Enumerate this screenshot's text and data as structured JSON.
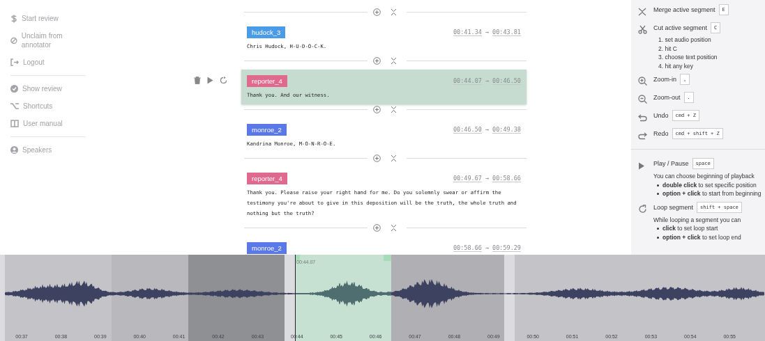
{
  "sidebar": {
    "groups": [
      {
        "items": [
          {
            "label": "Start review"
          },
          {
            "label": "Unclaim from annotator"
          },
          {
            "label": "Logout"
          }
        ]
      },
      {
        "items": [
          {
            "label": "Show review"
          },
          {
            "label": "Shortcuts"
          },
          {
            "label": "User manual"
          }
        ]
      },
      {
        "items": [
          {
            "label": "Speakers"
          }
        ]
      }
    ]
  },
  "segments": [
    {
      "speaker": "hudock_3",
      "color": "#4a9be8",
      "start": "00:41.34",
      "arrow": "→",
      "end": "00:43.81",
      "text": "Chris Hudock, H-U-D-O-C-K.",
      "selected": false
    },
    {
      "speaker": "reporter_4",
      "color": "#e0698f",
      "start": "00:44.07",
      "arrow": "→",
      "end": "00:46.50",
      "text": "Thank you. And our witness.",
      "selected": true
    },
    {
      "speaker": "monroe_2",
      "color": "#5b78e8",
      "start": "00:46.50",
      "arrow": "→",
      "end": "00:49.38",
      "text": "Kandrina Monroe, M-O-N-R-O-E.",
      "selected": false
    },
    {
      "speaker": "reporter_4",
      "color": "#e0698f",
      "start": "00:49.67",
      "arrow": "→",
      "end": "00:58.66",
      "text": "Thank you. Please raise your right hand for me. Do you solemnly swear or affirm the testimony you're about to give in this deposition will be the truth, the whole truth and nothing but the truth?",
      "selected": false
    },
    {
      "speaker": "monroe_2",
      "color": "#5b78e8",
      "start": "00:58.66",
      "arrow": "→",
      "end": "00:59.29",
      "selected": false
    }
  ],
  "shortcuts": {
    "sections": [
      {
        "items": [
          {
            "label": "Merge active segment",
            "key": "E"
          },
          {
            "label": "Cut active segment",
            "key": "C",
            "steps": [
              "1. set audio position",
              "2. hit C",
              "3. choose text position",
              "4. hit any key"
            ]
          },
          {
            "label": "Zoom-in",
            "key": ","
          },
          {
            "label": "Zoom-out",
            "key": "."
          },
          {
            "label": "Undo",
            "key": "cmd + Z"
          },
          {
            "label": "Redo",
            "key": "cmd + shift + Z"
          }
        ]
      },
      {
        "items": [
          {
            "label": "Play / Pause",
            "key": "space",
            "note": "You can choose beginning of playback",
            "bullets": [
              "**double click** to set specific position",
              "**option + click** to start from beginning"
            ]
          },
          {
            "label": "Loop segment",
            "key": "shift + space",
            "note": "While looping a segment you can",
            "bullets": [
              "**click** to set loop start",
              "**option + click** to set loop end"
            ]
          }
        ]
      }
    ]
  },
  "waveform": {
    "cursor_label": "00:44.07",
    "regions": [
      {
        "color": "#c4c4c8",
        "selected": false
      },
      {
        "color": "#b9b9bd",
        "selected": false
      },
      {
        "color": "#8f9094",
        "selected": false
      },
      {
        "color": "#c6e0d2",
        "selected": true
      },
      {
        "color": "#b0b0b4",
        "selected": false
      },
      {
        "color": "#c4c4c8",
        "selected": false
      }
    ],
    "ticks": [
      "00:37",
      "00:38",
      "00:39",
      "00:40",
      "00:41",
      "00:42",
      "00:43",
      "00:44",
      "00:45",
      "00:46",
      "00:47",
      "00:48",
      "00:49",
      "00:50",
      "00:51",
      "00:52",
      "00:53",
      "00:54",
      "00:55"
    ]
  }
}
